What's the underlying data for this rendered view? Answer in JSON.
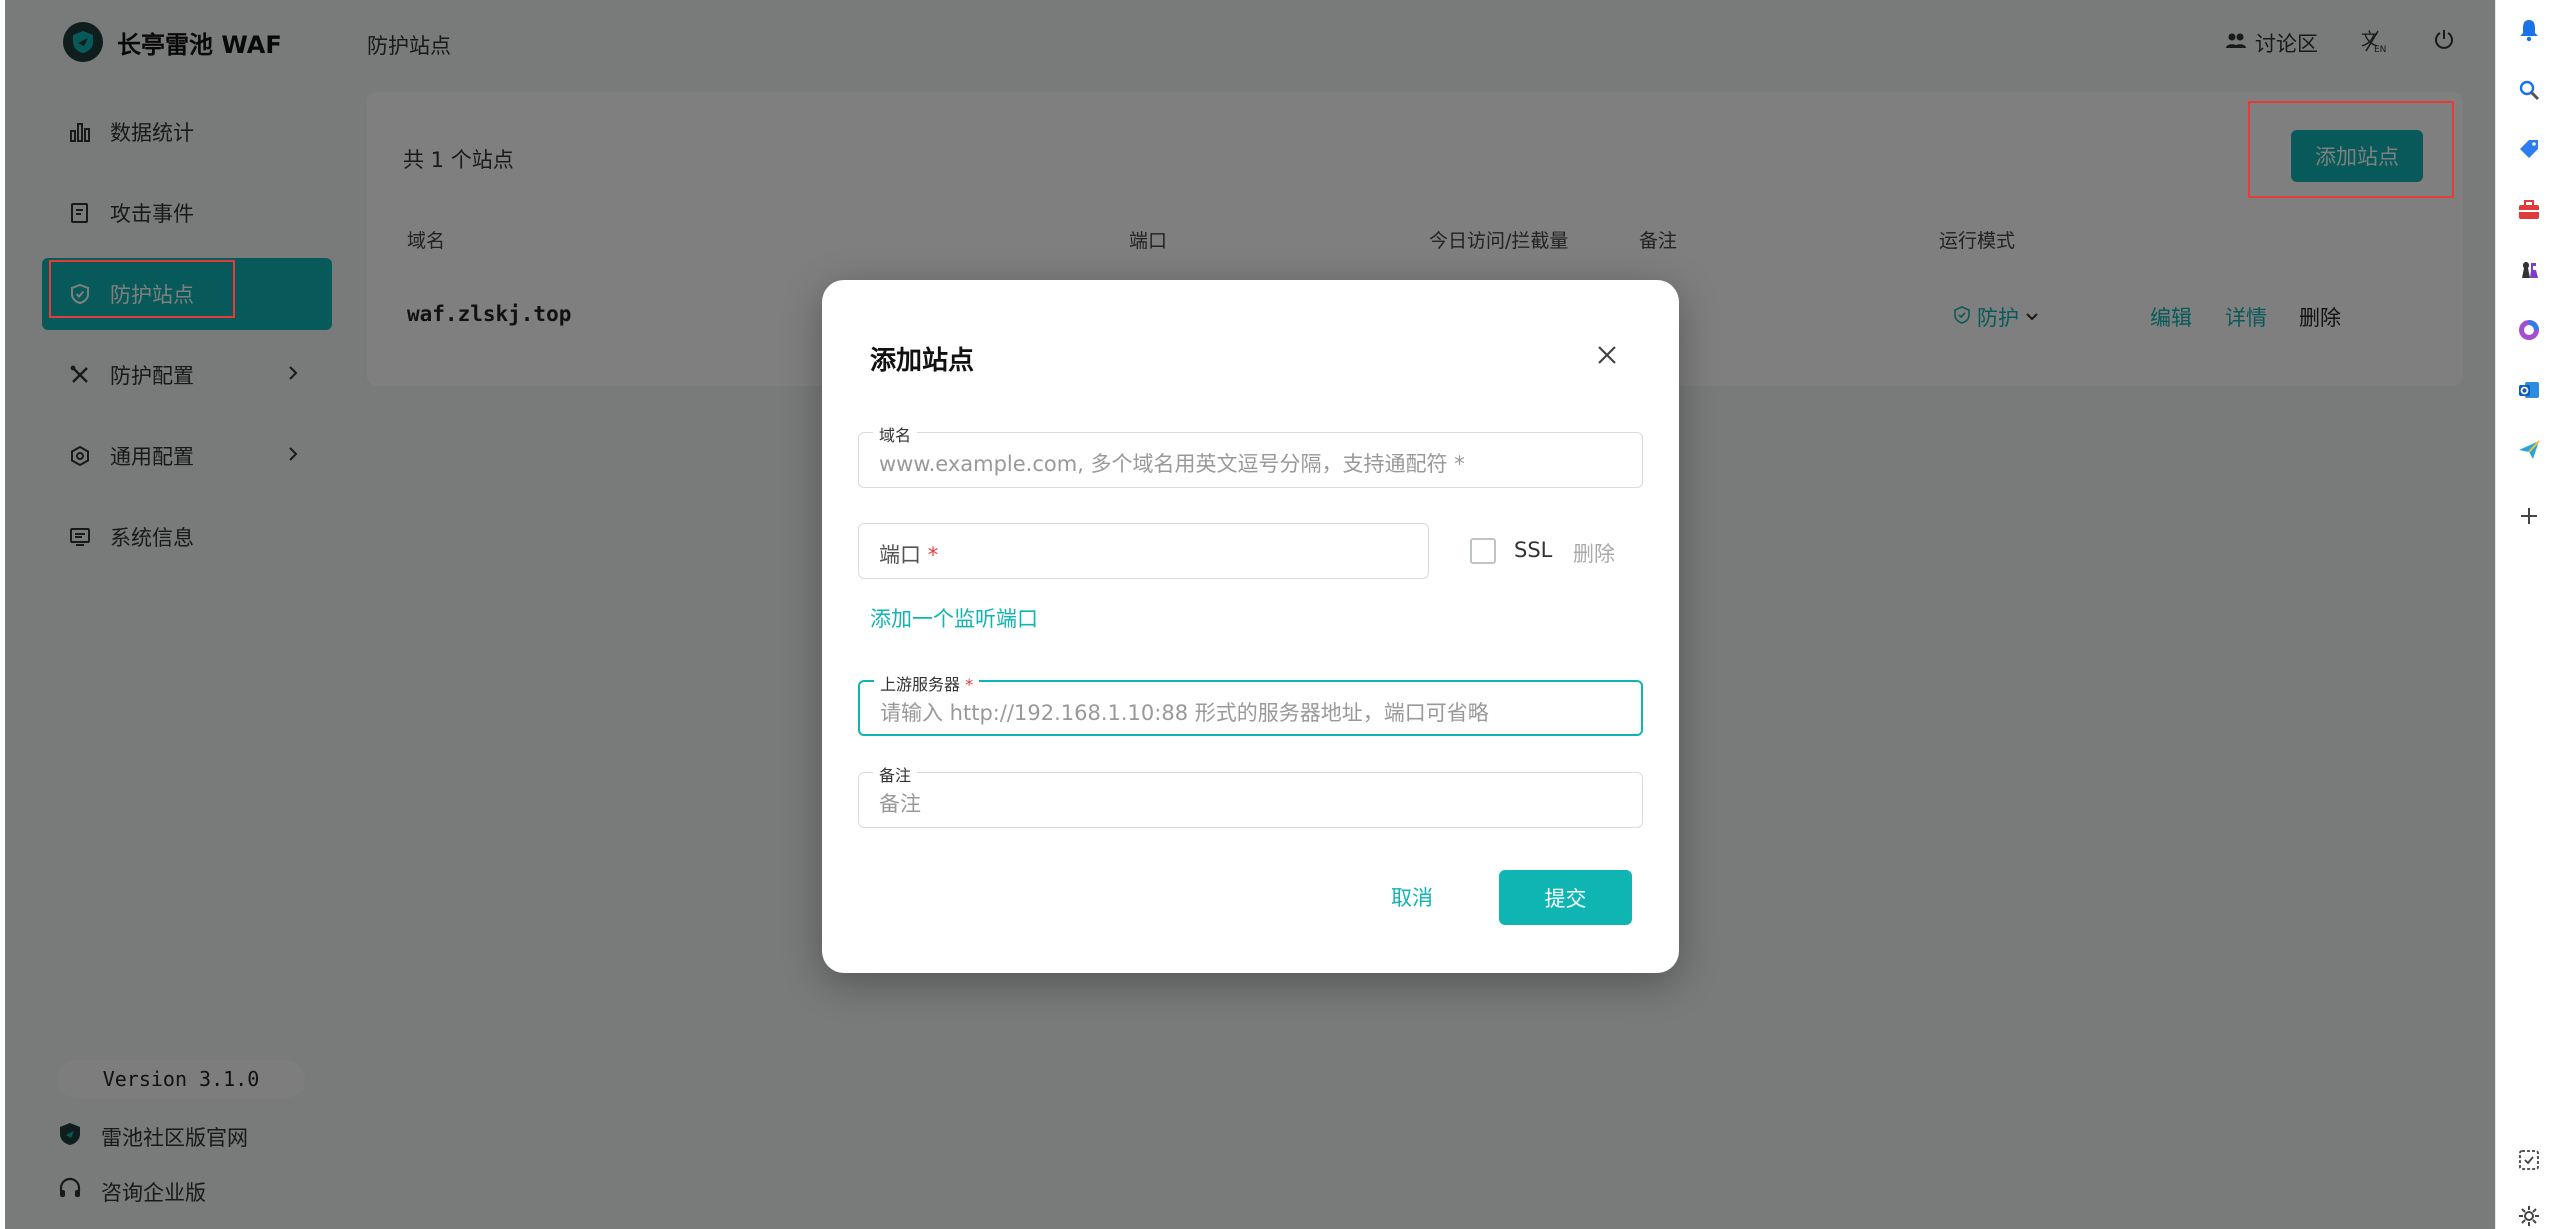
{
  "app": {
    "name": "长亭雷池 WAF",
    "page_title": "防护站点"
  },
  "sidebar": {
    "items": [
      {
        "label": "数据统计",
        "icon": "bar-chart-icon"
      },
      {
        "label": "攻击事件",
        "icon": "document-icon"
      },
      {
        "label": "防护站点",
        "icon": "shield-icon",
        "active": true
      },
      {
        "label": "防护配置",
        "icon": "tools-icon",
        "has_children": true
      },
      {
        "label": "通用配置",
        "icon": "gear-icon",
        "has_children": true
      },
      {
        "label": "系统信息",
        "icon": "monitor-icon"
      }
    ],
    "version": "Version 3.1.0",
    "footer_links": [
      "雷池社区版官网",
      "咨询企业版"
    ]
  },
  "topbar": {
    "forum_label": "讨论区",
    "lang_icon": "translate-icon",
    "logout_icon": "power-icon"
  },
  "sites": {
    "count_text": "共 1 个站点",
    "add_button": "添加站点",
    "columns": [
      "域名",
      "端口",
      "今日访问/拦截量",
      "备注",
      "运行模式"
    ],
    "rows": [
      {
        "domain": "waf.zlskj.top",
        "mode": "防护",
        "actions": [
          "编辑",
          "详情",
          "删除"
        ]
      }
    ]
  },
  "modal": {
    "title": "添加站点",
    "domain": {
      "label": "域名",
      "placeholder": "www.example.com, 多个域名用英文逗号分隔，支持通配符 *"
    },
    "port": {
      "placeholder": "端口"
    },
    "ssl_label": "SSL",
    "delete_label": "删除",
    "add_port_link": "添加一个监听端口",
    "upstream": {
      "label": "上游服务器",
      "placeholder": "请输入 http://192.168.1.10:88 形式的服务器地址，端口可省略"
    },
    "remark": {
      "label": "备注",
      "placeholder": "备注"
    },
    "cancel": "取消",
    "submit": "提交"
  },
  "colors": {
    "accent": "#0fb5b2",
    "highlight_box": "#e43b3b"
  }
}
